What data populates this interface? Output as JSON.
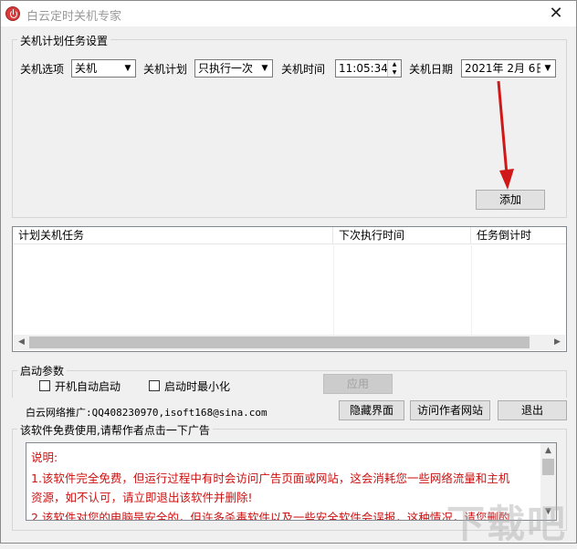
{
  "window": {
    "title": "白云定时关机专家",
    "close_symbol": "✕"
  },
  "plan_group": {
    "legend": "关机计划任务设置",
    "option_label": "关机选项",
    "option_value": "关机",
    "plan_label": "关机计划",
    "plan_value": "只执行一次",
    "time_label": "关机时间",
    "time_value": "11:05:34",
    "date_label": "关机日期",
    "date_value": "2021年 2月 6日",
    "add_button": "添加"
  },
  "task_list": {
    "columns": [
      "计划关机任务",
      "下次执行时间",
      "任务倒计时"
    ],
    "rows": []
  },
  "startup_group": {
    "legend": "启动参数",
    "autostart_label": "开机自动启动",
    "autostart_checked": false,
    "minimize_label": "启动时最小化",
    "minimize_checked": false,
    "apply_button": "应用"
  },
  "footer": {
    "promo_text": "白云网络推广:QQ408230970,isoft168@sina.com",
    "hide_button": "隐藏界面",
    "visit_button": "访问作者网站",
    "exit_button": "退出"
  },
  "ad_group": {
    "legend": "该软件免费使用,请帮作者点击一下广告",
    "lines": [
      "说明:",
      "1.该软件完全免费，但运行过程中有时会访问广告页面或网站，这会消耗您一些网络流量和主机",
      "资源，如不认可，请立即退出该软件并删除!",
      "2.该软件对您的电脑是安全的，但许多杀毒软件以及一些安全软件会误报，这种情况，请您删酌"
    ]
  },
  "watermark": "下载吧",
  "colors": {
    "ad_text": "#cc1111",
    "arrow": "#d01818",
    "focus_border": "#0078d7"
  }
}
